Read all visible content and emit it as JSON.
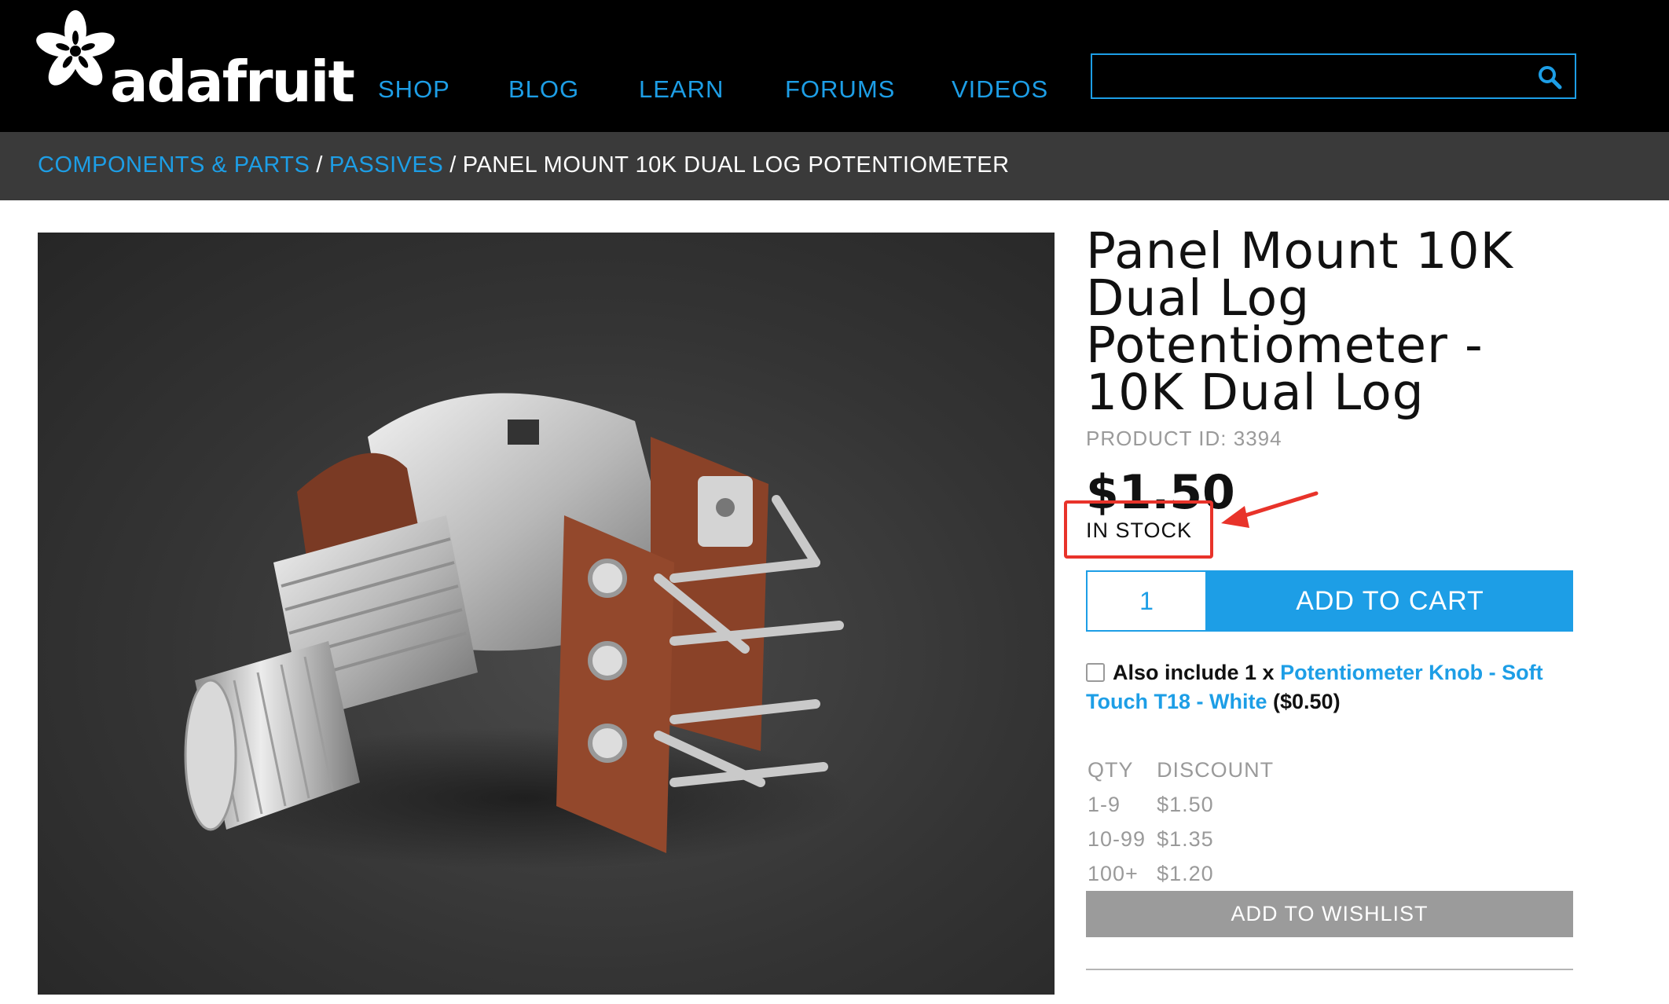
{
  "brand": {
    "name": "adafruit",
    "logo_icon": "flower-logo-icon"
  },
  "nav": {
    "items": [
      "SHOP",
      "BLOG",
      "LEARN",
      "FORUMS",
      "VIDEOS"
    ]
  },
  "search": {
    "value": "",
    "icon": "search-icon"
  },
  "breadcrumb": {
    "items": [
      "COMPONENTS & PARTS",
      "PASSIVES",
      "PANEL MOUNT 10K DUAL LOG POTENTIOMETER"
    ],
    "separator": "/"
  },
  "product": {
    "image_icon": "potentiometer-photo",
    "title": "Panel Mount 10K Dual Log Potentiometer - 10K Dual Log",
    "product_id": "PRODUCT ID: 3394",
    "price": "$1.50",
    "stock": "IN STOCK",
    "qty": "1",
    "add_to_cart": "ADD TO CART",
    "addon": {
      "prefix": "Also include 1 x",
      "link": "Potentiometer Knob - Soft Touch T18 - White",
      "price": "($0.50)"
    },
    "discount": {
      "headers": [
        "QTY",
        "DISCOUNT"
      ],
      "rows": [
        [
          "1-9",
          "$1.50"
        ],
        [
          "10-99",
          "$1.35"
        ],
        [
          "100+",
          "$1.20"
        ]
      ]
    },
    "wishlist": "ADD TO WISHLIST"
  },
  "colors": {
    "accent": "#1d9ee6",
    "header_bg": "#000000",
    "crumb_bg": "#3a3a3a",
    "highlight": "#e8332a",
    "wishlist_bg": "#9b9b9b"
  }
}
